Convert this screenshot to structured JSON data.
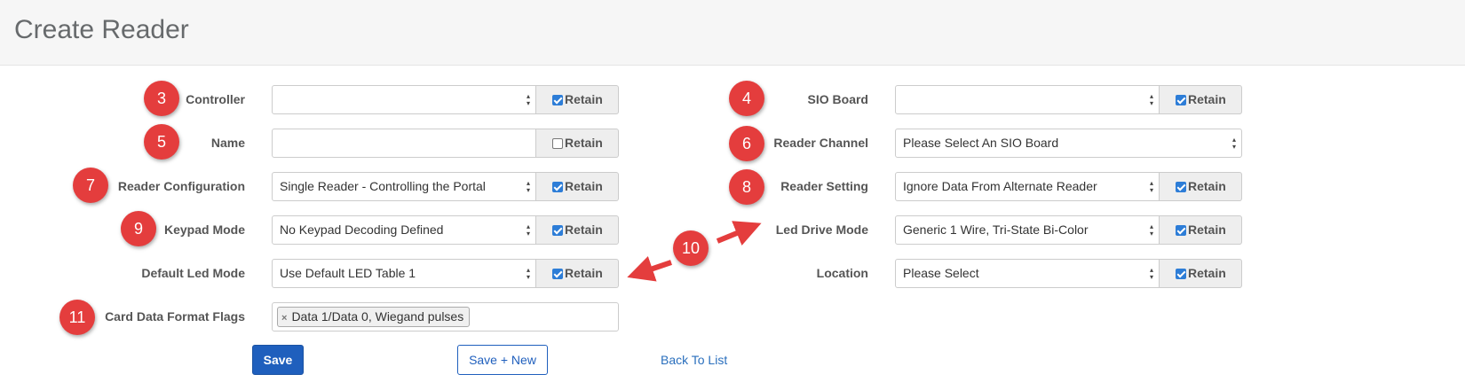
{
  "page": {
    "title": "Create Reader"
  },
  "left_form": {
    "controller": {
      "badge": "3",
      "label": "Controller",
      "value": "",
      "retain": "Retain",
      "retain_checked": true
    },
    "name": {
      "badge": "5",
      "label": "Name",
      "value": "",
      "retain": "Retain",
      "retain_checked": false
    },
    "reader_configuration": {
      "badge": "7",
      "label": "Reader Configuration",
      "value": "Single Reader - Controlling the Portal",
      "retain": "Retain",
      "retain_checked": true
    },
    "keypad_mode": {
      "badge": "9",
      "label": "Keypad Mode",
      "value": "No Keypad Decoding Defined",
      "retain": "Retain",
      "retain_checked": true
    },
    "default_led_mode": {
      "label": "Default Led Mode",
      "value": "Use Default LED Table 1",
      "retain": "Retain",
      "retain_checked": true
    },
    "card_data_format_flags": {
      "badge": "11",
      "label": "Card Data Format Flags",
      "tag_remove": "×",
      "tags": [
        "Data 1/Data 0, Wiegand pulses"
      ]
    }
  },
  "right_form": {
    "sio_board": {
      "badge": "4",
      "label": "SIO Board",
      "value": "",
      "retain": "Retain",
      "retain_checked": true
    },
    "reader_channel": {
      "badge": "6",
      "label": "Reader Channel",
      "value": "Please Select An SIO Board"
    },
    "reader_setting": {
      "badge": "8",
      "label": "Reader Setting",
      "value": "Ignore Data From Alternate Reader",
      "retain": "Retain",
      "retain_checked": true
    },
    "led_drive_mode": {
      "label": "Led Drive Mode",
      "value": "Generic 1 Wire, Tri-State Bi-Color",
      "retain": "Retain",
      "retain_checked": true
    },
    "location": {
      "label": "Location",
      "value": "Please Select",
      "retain": "Retain",
      "retain_checked": true
    }
  },
  "callout": {
    "badge": "10"
  },
  "actions": {
    "save": "Save",
    "save_new": "Save + New",
    "back": "Back To List"
  },
  "colors": {
    "badge": "#e43d3d",
    "primary": "#1f5fbd",
    "link": "#2a6fbd",
    "checkbox": "#2d7dd7"
  }
}
